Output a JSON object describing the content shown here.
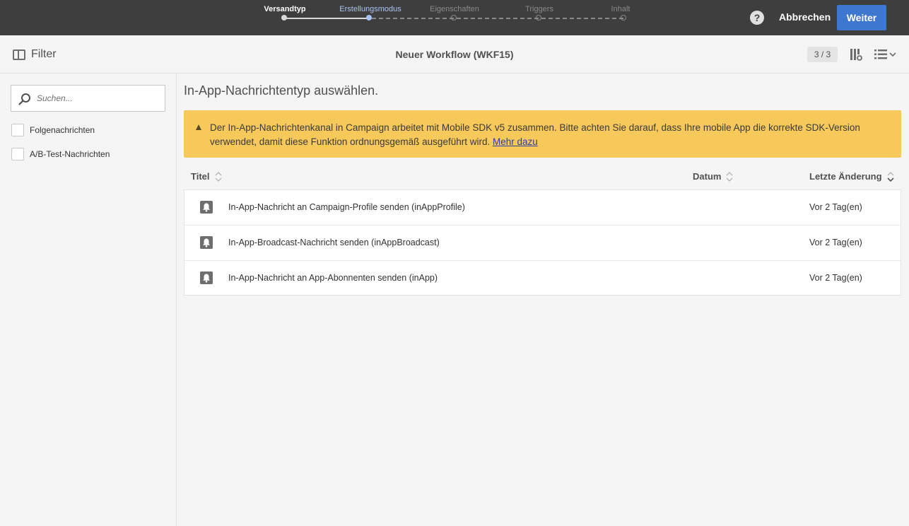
{
  "wizard": {
    "steps": [
      {
        "label": "Versandtyp",
        "state": "done"
      },
      {
        "label": "Erstellungsmodus",
        "state": "current"
      },
      {
        "label": "Eigenschaften",
        "state": "todo"
      },
      {
        "label": "Triggers",
        "state": "todo"
      },
      {
        "label": "Inhalt",
        "state": "todo"
      }
    ],
    "help_glyph": "?",
    "cancel_label": "Abbrechen",
    "next_label": "Weiter"
  },
  "header": {
    "filter_label": "Filter",
    "title": "Neuer Workflow (WKF15)",
    "counter": "3 / 3"
  },
  "sidebar": {
    "search_placeholder": "Suchen...",
    "filters": [
      {
        "label": "Folgenachrichten",
        "checked": false
      },
      {
        "label": "A/B-Test-Nachrichten",
        "checked": false
      }
    ]
  },
  "main": {
    "heading": "In-App-Nachrichtentyp auswählen.",
    "alert": {
      "text": "Der In-App-Nachrichtenkanal in Campaign arbeitet mit Mobile SDK v5 zusammen. Bitte achten Sie darauf, dass Ihre mobile App die korrekte SDK-Version verwendet, damit diese Funktion ordnungsgemäß ausgeführt wird.",
      "link": "Mehr dazu"
    },
    "columns": {
      "title": "Titel",
      "date": "Datum",
      "changed": "Letzte Änderung"
    },
    "rows": [
      {
        "icon": "bell-icon",
        "title": "In-App-Nachricht an Campaign-Profile senden (inAppProfile)",
        "date": "",
        "changed": "Vor 2 Tag(en)"
      },
      {
        "icon": "bell-icon",
        "title": "In-App-Broadcast-Nachricht senden (inAppBroadcast)",
        "date": "",
        "changed": "Vor 2 Tag(en)"
      },
      {
        "icon": "bell-icon",
        "title": "In-App-Nachricht an App-Abonnenten senden (inApp)",
        "date": "",
        "changed": "Vor 2 Tag(en)"
      }
    ]
  },
  "colors": {
    "topbar": "#3e3e3e",
    "primary_button": "#3e77d0",
    "alert_background": "#f7c85a",
    "current_step": "#a8c4ef"
  }
}
